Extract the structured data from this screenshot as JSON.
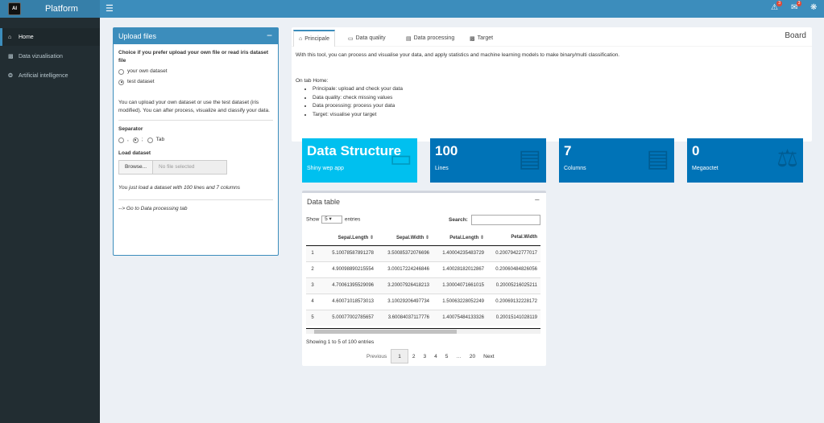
{
  "header": {
    "logo_text": "AI",
    "brand": "Platform",
    "toggle_icon": "hamburger-icon",
    "warning_badge": "3",
    "mail_badge": "3"
  },
  "sidebar": {
    "items": [
      {
        "label": "Home",
        "icon": "home-icon"
      },
      {
        "label": "Data vizualisation",
        "icon": "bar-chart-icon"
      },
      {
        "label": "Artificial intelligence",
        "icon": "brain-icon"
      }
    ]
  },
  "upload": {
    "title": "Upload files",
    "minimize": "−",
    "choice_label": "Choice if you prefer upload your own file or read iris dataset file",
    "options": [
      "your own dataset",
      "test dataset"
    ],
    "selected_option": "test dataset",
    "help": "You can upload your own dataset or use the test dataset (iris modified). You can after process, visualize and classify your data.",
    "separator_label": "Separator",
    "separator_options": [
      ",",
      ";",
      "Tab"
    ],
    "separator_selected": ";",
    "load_label": "Load dataset",
    "browse_label": "Browse...",
    "file_placeholder": "No file selected",
    "loaded_msg": "You just load a dataset with 100 lines and 7 columns",
    "goto": "--> Go to Data processing tab"
  },
  "tabs": {
    "items": [
      "Principale",
      "Data quality",
      "Data processing",
      "Target"
    ],
    "active": "Principale",
    "board": "Board",
    "intro": "With this tool, you can process and visualise your data, and apply statistics and machine learning models to make binary/multi classification.",
    "home_title": "On tab Home:",
    "bullets": [
      "Principale: upload and check your data",
      "Data quality: check missing values",
      "Data processing: process your data",
      "Target: visualise your target"
    ]
  },
  "value_boxes": [
    {
      "value": "Data Structure",
      "subtitle": "Shiny wep app",
      "color": "#00c0ef",
      "icon": "monitor-icon"
    },
    {
      "value": "100",
      "subtitle": "Lines",
      "color": "#0073b7",
      "icon": "list-icon"
    },
    {
      "value": "7",
      "subtitle": "Columns",
      "color": "#0073b7",
      "icon": "ruler-icon"
    },
    {
      "value": "0",
      "subtitle": "Megaoctet",
      "color": "#0073b7",
      "icon": "balance-scale-icon"
    }
  ],
  "datatable": {
    "title": "Data table",
    "minimize": "−",
    "show_label": "Show",
    "entries_value": "5",
    "entries_label": "entries",
    "search_label": "Search:",
    "columns": [
      "",
      "Sepal.Length",
      "Sepal.Width",
      "Petal.Length",
      "Petal.Width"
    ],
    "rows": [
      [
        "1",
        "5.10078587891278",
        "3.50085372076696",
        "1.40004235483729",
        "0.20079422777017"
      ],
      [
        "2",
        "4.90098890215554",
        "3.00017224246846",
        "1.40028182012867",
        "0.20060484826056"
      ],
      [
        "3",
        "4.70061395529096",
        "3.20007926418213",
        "1.30004071661015",
        "0.20005216025211"
      ],
      [
        "4",
        "4.60071018573013",
        "3.10029206497734",
        "1.50063228052249",
        "0.20069132228172"
      ],
      [
        "5",
        "5.00077002785657",
        "3.60084037117776",
        "1.40075484133326",
        "0.20015141028119"
      ]
    ],
    "info": "Showing 1 to 5 of 100 entries",
    "pager": {
      "previous": "Previous",
      "pages": [
        "1",
        "2",
        "3",
        "4",
        "5",
        "…",
        "20"
      ],
      "current": "1",
      "next": "Next"
    }
  }
}
